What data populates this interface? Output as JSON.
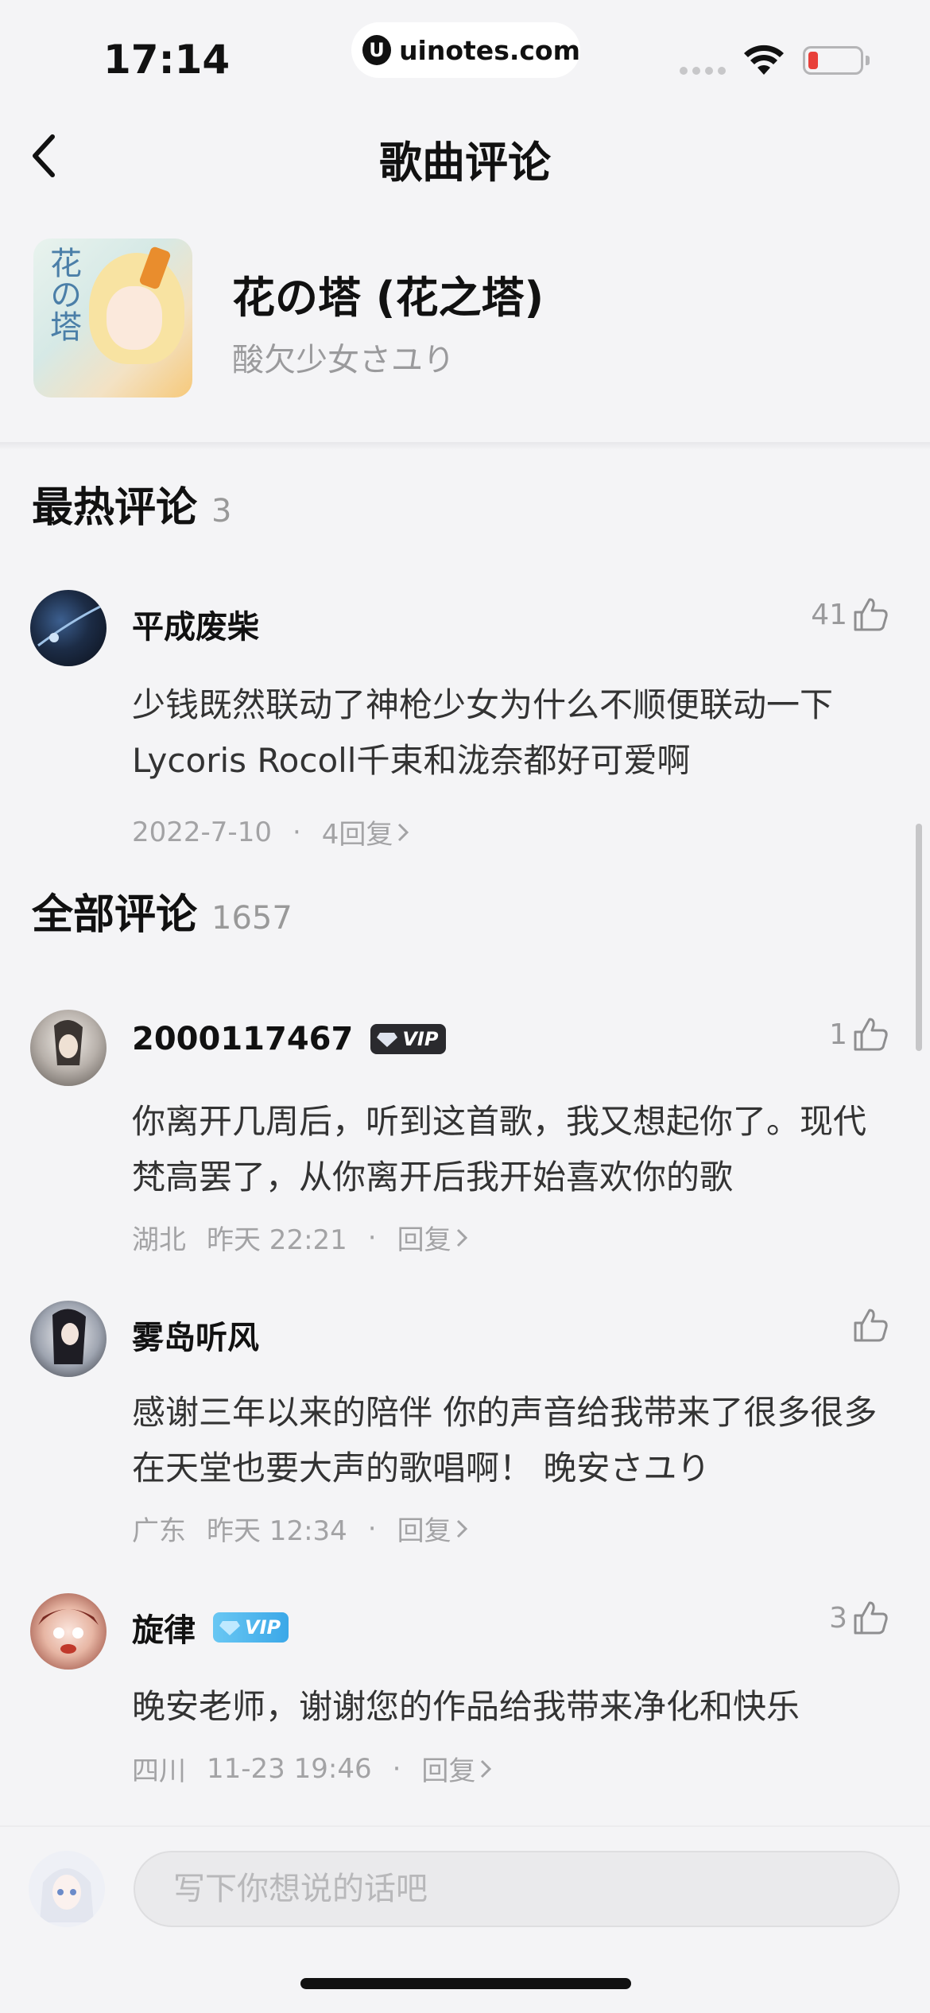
{
  "status_bar": {
    "time": "17:14",
    "watermark": "uinotes.com",
    "watermark_logo": "U",
    "icons": [
      "signal-icon",
      "wifi-icon",
      "battery-icon"
    ]
  },
  "nav": {
    "title": "歌曲评论",
    "back_icon": "chevron-left-icon"
  },
  "song": {
    "title": "花の塔 (花之塔)",
    "artist": "酸欠少女さユり",
    "cover_text": "花の塔"
  },
  "hot": {
    "title": "最热评论",
    "count": "3",
    "comments": [
      {
        "user": "平成废柴",
        "likes": "41",
        "text": "少钱既然联动了神枪少女为什么不顺便联动一下Lycoris Rocoll千束和泷奈都好可爱啊",
        "date": "2022-7-10",
        "dot": "·",
        "replies": "4回复"
      }
    ]
  },
  "all": {
    "title": "全部评论",
    "count": "1657",
    "comments": [
      {
        "user": "2000117467",
        "vip": "VIP",
        "likes": "1",
        "text": "你离开几周后，听到这首歌，我又想起你了。现代梵高罢了，从你离开后我开始喜欢你的歌",
        "location": "湖北",
        "time": "昨天 22:21",
        "dot": "·",
        "reply": "回复"
      },
      {
        "user": "雾岛听风",
        "likes": "",
        "text": "感谢三年以来的陪伴 你的声音给我带来了很多很多 在天堂也要大声的歌唱啊！ 晚安さユり",
        "location": "广东",
        "time": "昨天 12:34",
        "dot": "·",
        "reply": "回复"
      },
      {
        "user": "旋律",
        "vip": "VIP",
        "likes": "3",
        "text": "晚安老师，谢谢您的作品给我带来净化和快乐",
        "location": "四川",
        "time": "11-23 19:46",
        "dot": "·",
        "reply": "回复"
      }
    ]
  },
  "input": {
    "placeholder": "写下你想说的话吧",
    "value": ""
  },
  "colors": {
    "background": "#f4f4f6",
    "text_primary": "#111111",
    "text_secondary": "#9a9a9c",
    "vip_blue": "#3ba8e8",
    "battery_low": "#e8403a"
  }
}
